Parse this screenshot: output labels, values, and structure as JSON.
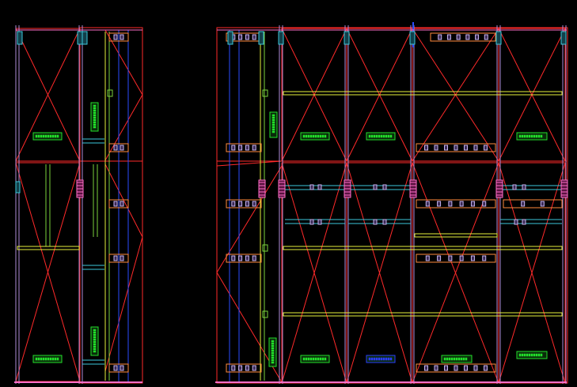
{
  "drawing": {
    "background": "#000000",
    "colors": {
      "frame": "#ff2a2a",
      "frame_dark": "#c81e1e",
      "post": "#b08cd8",
      "beam_yellow": "#e6f03c",
      "rail_green": "#7ad23c",
      "post_blue": "#2a4cff",
      "cyan": "#3cc8dc",
      "pink": "#ff6ec8",
      "orange": "#ff8a3c",
      "lavender": "#c8b4f0",
      "tag_green": "#22e02a",
      "tag_blue": "#2a3cff"
    },
    "panel_tags": [
      {
        "id": "left-top",
        "color": "green"
      },
      {
        "id": "left-bottom",
        "color": "green"
      },
      {
        "id": "right-top-1",
        "color": "green"
      },
      {
        "id": "right-top-2",
        "color": "green"
      },
      {
        "id": "right-top-4",
        "color": "green"
      },
      {
        "id": "right-bot-1",
        "color": "green"
      },
      {
        "id": "right-bot-2",
        "color": "blue"
      },
      {
        "id": "right-bot-3",
        "color": "green"
      },
      {
        "id": "right-bot-4",
        "color": "green"
      },
      {
        "id": "left-vert-top",
        "color": "green",
        "vertical": true
      },
      {
        "id": "left-vert-bot",
        "color": "green",
        "vertical": true
      },
      {
        "id": "right-vert-top",
        "color": "green",
        "vertical": true
      },
      {
        "id": "right-vert-bot",
        "color": "green",
        "vertical": true
      }
    ]
  }
}
